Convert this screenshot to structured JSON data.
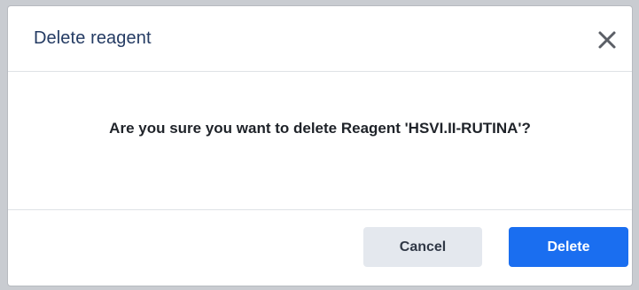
{
  "dialog": {
    "title": "Delete reagent",
    "close_icon": "close-icon",
    "message": "Are you sure you want to delete Reagent 'HSVI.II-RUTINA'?",
    "cancel_label": "Cancel",
    "delete_label": "Delete"
  },
  "colors": {
    "title": "#243b63",
    "primary": "#1a6ef0",
    "secondary_bg": "#e4e8ee"
  }
}
